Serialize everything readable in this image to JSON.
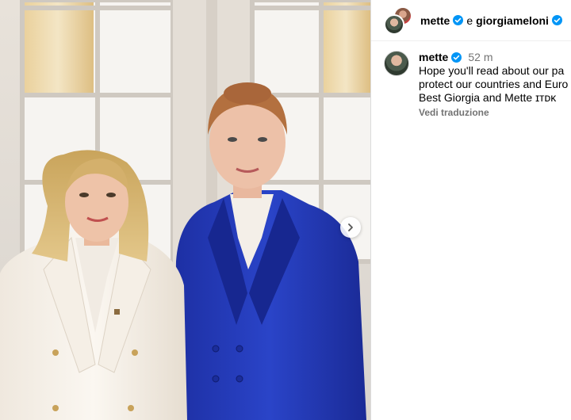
{
  "header": {
    "user1": "mette",
    "connector": "e",
    "user2": "giorgiameloni"
  },
  "caption": {
    "username": "mette",
    "time": "52 m",
    "lines": [
      "Hope you'll read about our pa",
      "protect our countries and Euro",
      "Best Giorgia and Mette ɪᴛᴅᴋ"
    ],
    "translate_label": "Vedi traduzione"
  },
  "icons": {
    "verified": "verified-badge-icon",
    "next": "chevron-right-icon"
  },
  "colors": {
    "verified_blue": "#0095f6",
    "suit_blue": "#2238b8",
    "muted_text": "#737373"
  }
}
